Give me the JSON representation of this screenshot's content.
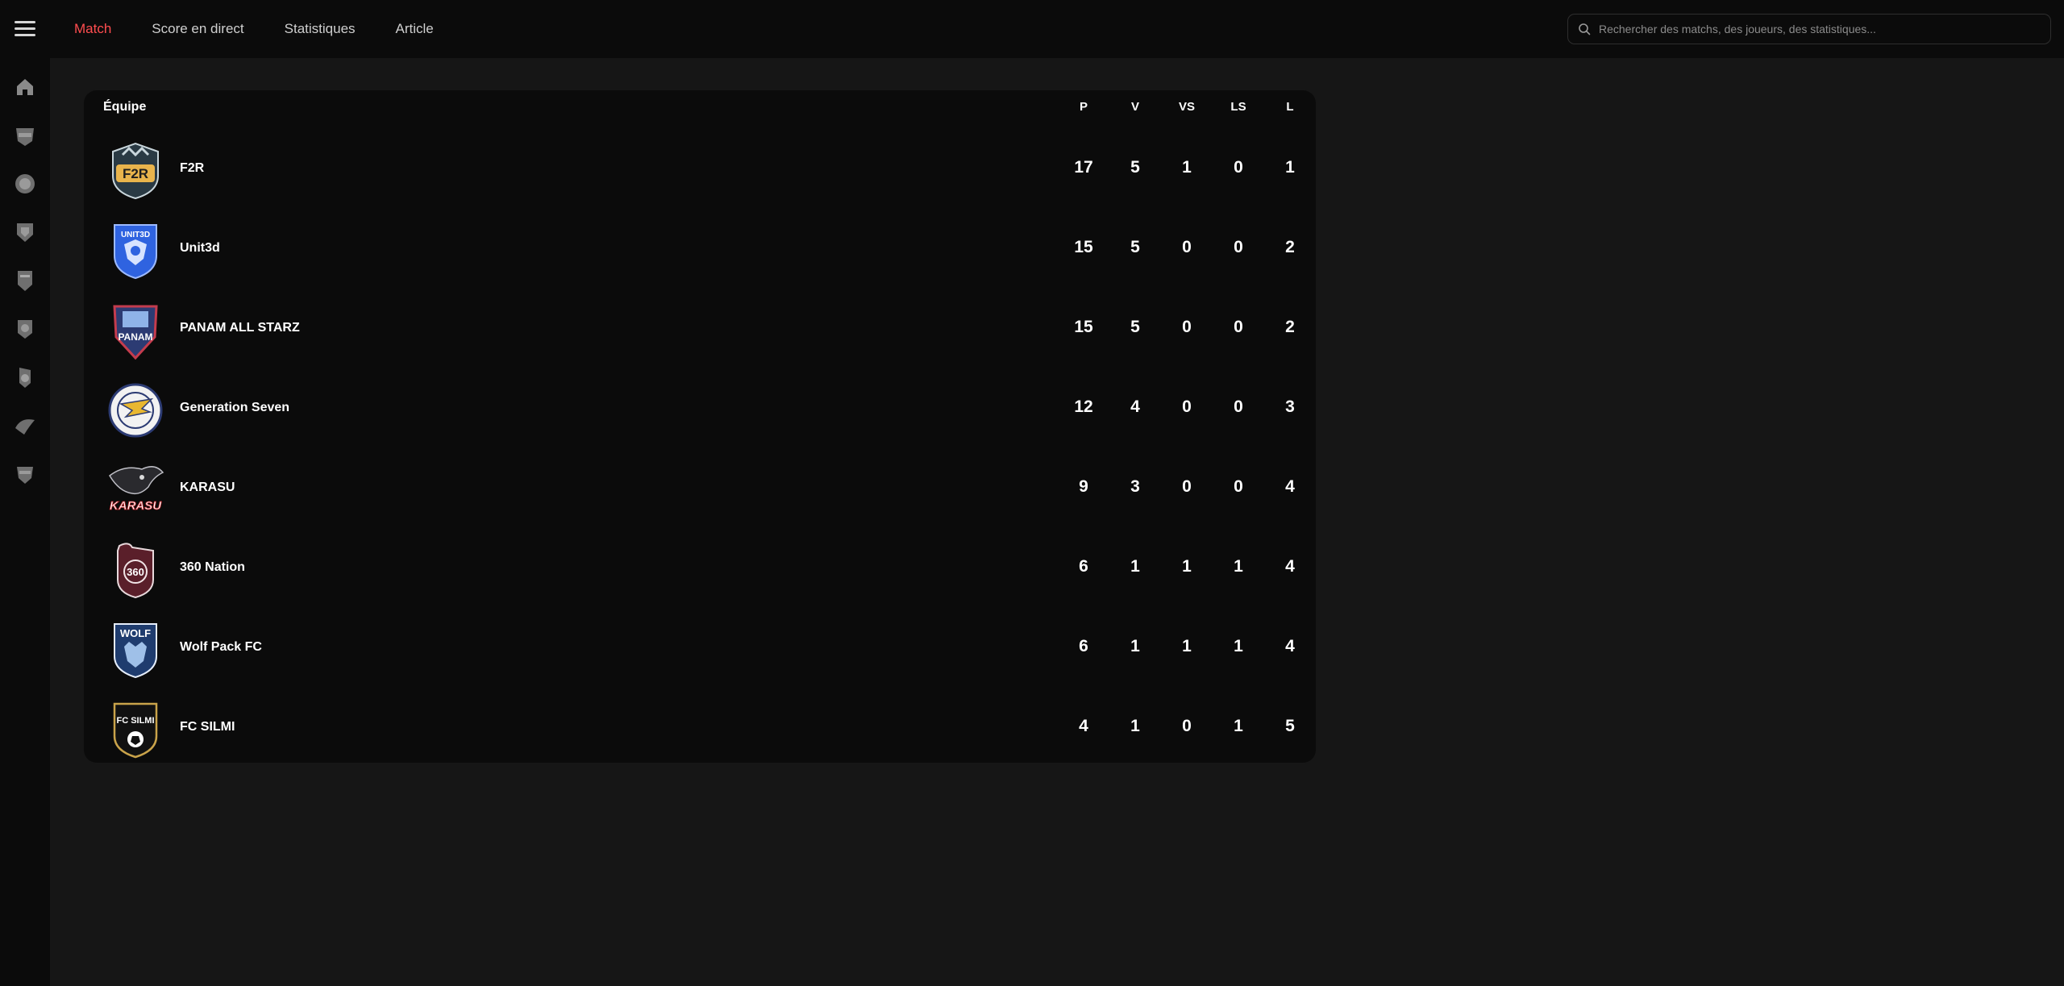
{
  "nav": {
    "items": [
      "Match",
      "Score en direct",
      "Statistiques",
      "Article"
    ],
    "active": 0
  },
  "search": {
    "placeholder": "Rechercher des matchs, des joueurs, des statistiques..."
  },
  "sidebar": {
    "icons": [
      "home-icon",
      "team-logo-icon",
      "team-logo-icon",
      "team-logo-icon",
      "team-logo-icon",
      "team-logo-icon",
      "team-logo-icon",
      "team-logo-icon",
      "team-logo-icon"
    ]
  },
  "standings": {
    "header": {
      "team": "Équipe",
      "cols": [
        "P",
        "V",
        "VS",
        "LS",
        "L"
      ]
    },
    "rows": [
      {
        "name": "F2R",
        "logo_text": "F2R",
        "p": "17",
        "v": "5",
        "vs": "1",
        "ls": "0",
        "l": "1"
      },
      {
        "name": "Unit3d",
        "logo_text": "UNIT3D",
        "p": "15",
        "v": "5",
        "vs": "0",
        "ls": "0",
        "l": "2"
      },
      {
        "name": "PANAM ALL STARZ",
        "logo_text": "PANAM",
        "p": "15",
        "v": "5",
        "vs": "0",
        "ls": "0",
        "l": "2"
      },
      {
        "name": "Generation Seven",
        "logo_text": "",
        "p": "12",
        "v": "4",
        "vs": "0",
        "ls": "0",
        "l": "3"
      },
      {
        "name": "KARASU",
        "logo_text": "KARASU",
        "p": "9",
        "v": "3",
        "vs": "0",
        "ls": "0",
        "l": "4"
      },
      {
        "name": "360 Nation",
        "logo_text": "360",
        "p": "6",
        "v": "1",
        "vs": "1",
        "ls": "1",
        "l": "4"
      },
      {
        "name": "Wolf Pack FC",
        "logo_text": "WOLF",
        "p": "6",
        "v": "1",
        "vs": "1",
        "ls": "1",
        "l": "4"
      },
      {
        "name": "FC SILMI",
        "logo_text": "FC SILMI",
        "p": "4",
        "v": "1",
        "vs": "0",
        "ls": "1",
        "l": "5"
      }
    ]
  },
  "colors": {
    "accent": "#ff4d4f",
    "panel": "#0b0b0b",
    "page": "#161616"
  }
}
